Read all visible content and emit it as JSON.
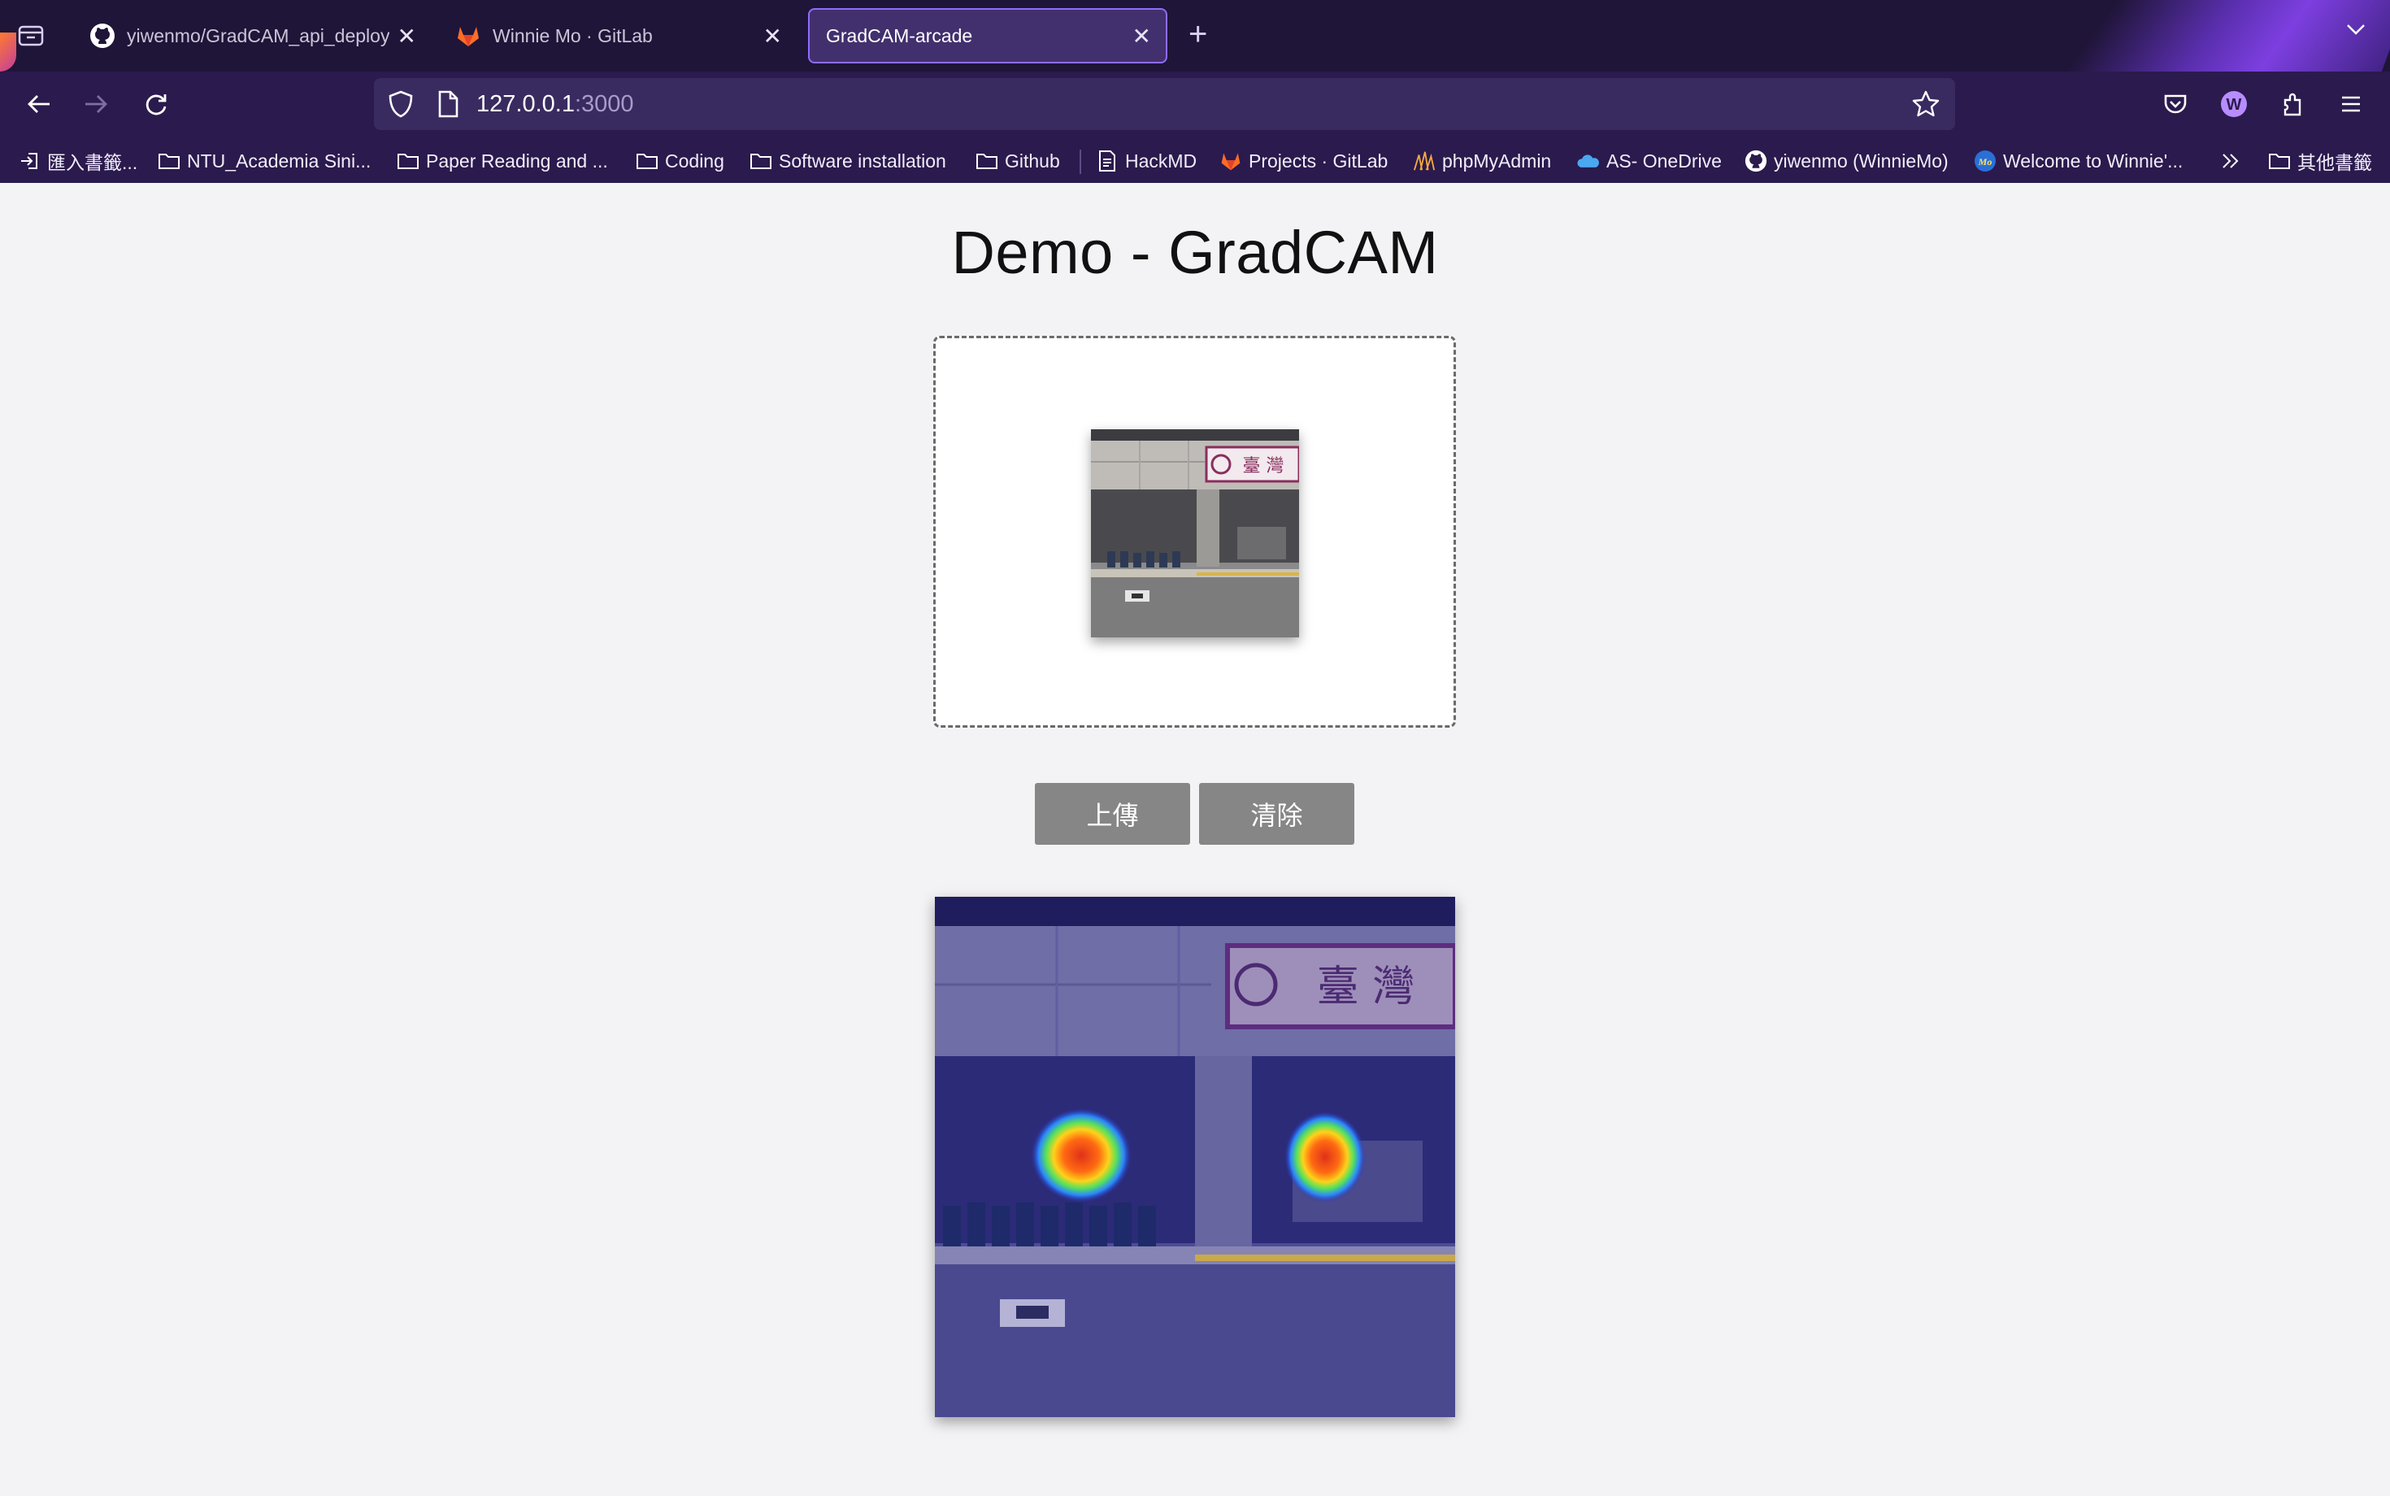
{
  "browser": {
    "tabs": [
      {
        "label": "yiwenmo/GradCAM_api_deploy",
        "icon": "github-icon",
        "active": false
      },
      {
        "label": "Winnie Mo · GitLab",
        "icon": "gitlab-icon",
        "active": false
      },
      {
        "label": "GradCAM-arcade",
        "icon": "",
        "active": true
      }
    ],
    "url_host": "127.0.0.1",
    "url_port": ":3000",
    "bookmarks": [
      {
        "label": "匯入書籤...",
        "icon": "import-icon"
      },
      {
        "label": "NTU_Academia Sini...",
        "icon": "folder-icon"
      },
      {
        "label": "Paper Reading and ...",
        "icon": "folder-icon"
      },
      {
        "label": "Coding",
        "icon": "folder-icon"
      },
      {
        "label": "Software installation",
        "icon": "folder-icon"
      },
      {
        "label": "Github",
        "icon": "folder-icon"
      },
      {
        "label": "HackMD",
        "icon": "hackmd-icon"
      },
      {
        "label": "Projects · GitLab",
        "icon": "gitlab-icon"
      },
      {
        "label": "phpMyAdmin",
        "icon": "phpmyadmin-icon"
      },
      {
        "label": "AS- OneDrive",
        "icon": "onedrive-icon"
      },
      {
        "label": "yiwenmo (WinnieMo)",
        "icon": "github-icon"
      },
      {
        "label": "Welcome to Winnie'...",
        "icon": "site-icon"
      },
      {
        "label": "其他書籤",
        "icon": "folder-icon"
      }
    ],
    "colors": {
      "chrome": "#2b1a4d",
      "tabstrip": "#1f1538",
      "active_tab_border": "#8f6cff"
    }
  },
  "page": {
    "title": "Demo - GradCAM",
    "upload_button": "上傳",
    "clear_button": "清除",
    "thumbnail_sign": "臺 灣",
    "result_sign": "臺 灣",
    "colors": {
      "background": "#f3f3f5",
      "button": "#868686"
    }
  }
}
